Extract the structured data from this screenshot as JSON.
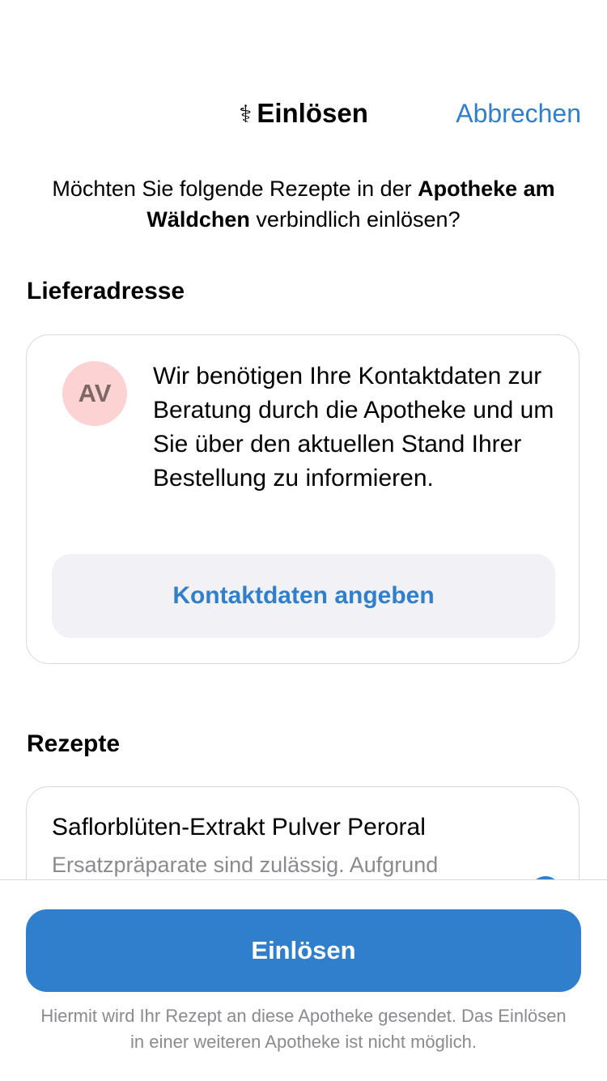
{
  "nav": {
    "icon": "caduceus-icon",
    "icon_glyph": "⚕",
    "title": "Einlösen",
    "cancel_label": "Abbrechen"
  },
  "intro": {
    "text_before": "Möchten Sie folgende Rezepte in der ",
    "pharmacy_name": "Apotheke am Wäldchen",
    "text_after": " verbindlich einlösen?"
  },
  "delivery": {
    "heading": "Lieferadresse",
    "avatar_initials": "AV",
    "info_text": "Wir benötigen Ihre Kontaktdaten zur Beratung durch die Apotheke und um Sie über den aktuellen Stand Ihrer Bestellung zu informieren.",
    "contact_button_label": "Kontaktdaten angeben"
  },
  "prescriptions": {
    "heading": "Rezepte",
    "items": [
      {
        "title": "Saflorblüten-Extrakt Pulver Peroral",
        "subtitle": "Ersatzpräparate sind zulässig. Aufgrund"
      }
    ]
  },
  "footer": {
    "redeem_button_label": "Einlösen",
    "note": "Hiermit wird Ihr Rezept an diese Apotheke gesendet. Das Einlösen in einer weiteren Apotheke ist nicht möglich."
  },
  "colors": {
    "accent": "#2f7fcd",
    "avatar_bg": "#fcd3d2",
    "secondary_button_bg": "#f1f1f6",
    "muted_text": "#8a8a8f"
  }
}
